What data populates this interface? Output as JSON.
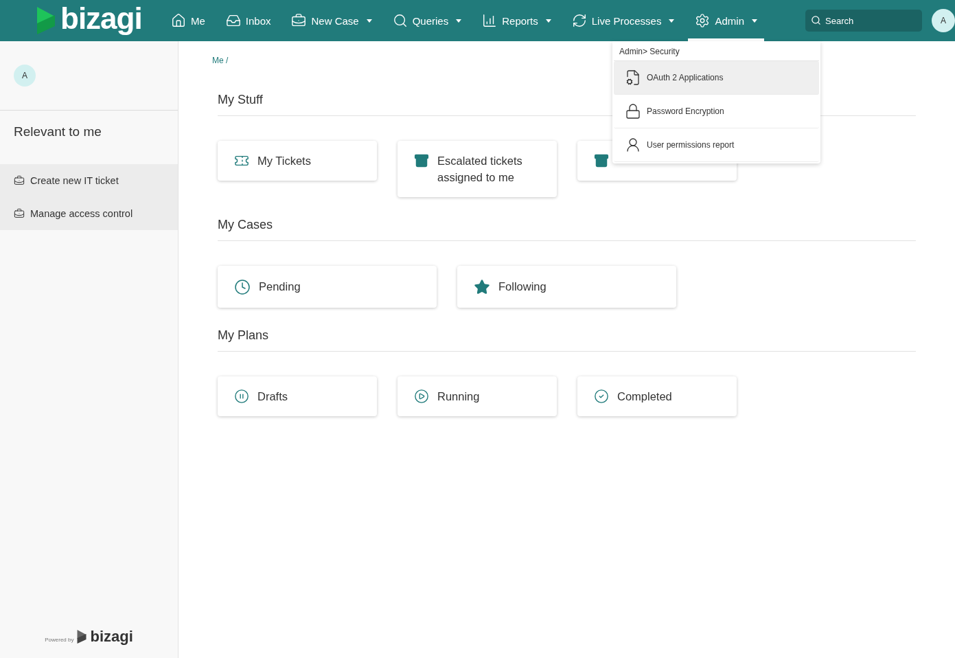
{
  "header": {
    "logo": "bizagi",
    "nav": [
      {
        "kind": "home",
        "label": "Me",
        "caret": false,
        "selected": false
      },
      {
        "kind": "inbox",
        "label": "Inbox",
        "caret": false,
        "selected": false
      },
      {
        "kind": "case",
        "label": "New Case",
        "caret": true,
        "selected": false
      },
      {
        "kind": "search",
        "label": "Queries",
        "caret": true,
        "selected": false
      },
      {
        "kind": "chart",
        "label": "Reports",
        "caret": true,
        "selected": false
      },
      {
        "kind": "live",
        "label": "Live Processes",
        "caret": true,
        "selected": false
      },
      {
        "kind": "gear",
        "label": "Admin",
        "caret": true,
        "selected": true
      }
    ],
    "search": {
      "placeholder": "Search"
    },
    "avatar": "A"
  },
  "sidebar": {
    "avatar": "A",
    "heading": "Relevant to me",
    "items": [
      {
        "label": "Create new IT ticket"
      },
      {
        "label": "Manage access control"
      }
    ],
    "footer": {
      "powered": "Powered by",
      "logo": "bizagi"
    }
  },
  "breadcrumb": "Me /",
  "sections": [
    {
      "title": "My Stuff",
      "cards": [
        {
          "kind": "ticket",
          "label": "My Tickets"
        },
        {
          "kind": "archive",
          "label": "Escalated tickets assigned to me"
        },
        {
          "kind": "archive"
        }
      ]
    },
    {
      "title": "My Cases",
      "cards": [
        {
          "kind": "clock",
          "label": "Pending"
        },
        {
          "kind": "star",
          "label": "Following"
        }
      ]
    },
    {
      "title": "My Plans",
      "cards": [
        {
          "kind": "pause",
          "label": "Drafts"
        },
        {
          "kind": "play",
          "label": "Running"
        },
        {
          "kind": "check",
          "label": "Completed"
        }
      ]
    }
  ],
  "dropdown": {
    "title": "Admin> Security",
    "items": [
      {
        "kind": "oauth",
        "label": "OAuth 2 Applications",
        "selected": true
      },
      {
        "kind": "lock",
        "label": "Password Encryption",
        "selected": false
      },
      {
        "kind": "user",
        "label": "User permissions report",
        "selected": false
      }
    ]
  }
}
